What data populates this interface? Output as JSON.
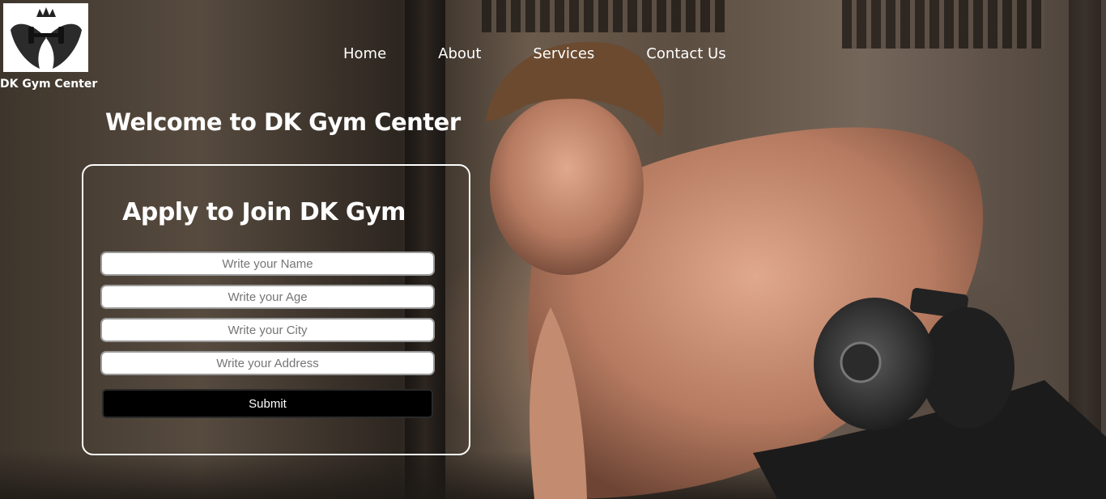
{
  "brand": {
    "logo_icon": "dumbbell-crest-logo",
    "name": "DK Gym Center"
  },
  "nav": {
    "items": [
      "Home",
      "About",
      "Services",
      "Contact Us"
    ]
  },
  "hero": {
    "welcome": "Welcome to DK Gym Center"
  },
  "form": {
    "title": "Apply to Join DK Gym",
    "fields": [
      {
        "placeholder": "Write your Name",
        "value": ""
      },
      {
        "placeholder": "Write your Age",
        "value": ""
      },
      {
        "placeholder": "Write your City",
        "value": ""
      },
      {
        "placeholder": "Write your Address",
        "value": ""
      }
    ],
    "submit_label": "Submit"
  },
  "colors": {
    "text": "#ffffff",
    "button_bg": "#000000",
    "card_border": "#ffffff"
  }
}
